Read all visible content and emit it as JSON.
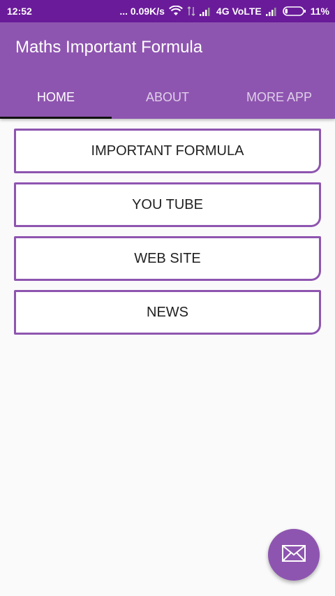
{
  "status_bar": {
    "time": "12:52",
    "network_speed": "... 0.09K/s",
    "network_type": "4G VoLTE",
    "battery": "11%",
    "icons": [
      "wifi-icon",
      "data-arrows-icon",
      "signal-icon",
      "signal-icon-2",
      "battery-icon"
    ]
  },
  "app_bar": {
    "title": "Maths Important Formula"
  },
  "tabs": [
    {
      "label": "HOME",
      "active": true
    },
    {
      "label": "ABOUT",
      "active": false
    },
    {
      "label": "MORE APP",
      "active": false
    }
  ],
  "buttons": [
    {
      "label": "IMPORTANT FORMULA"
    },
    {
      "label": "YOU TUBE"
    },
    {
      "label": "WEB SITE"
    },
    {
      "label": "NEWS"
    }
  ],
  "fab": {
    "icon": "mail-icon"
  },
  "colors": {
    "status_bar": "#6a1b9a",
    "primary": "#8e55b0",
    "background": "#fafafa",
    "button_text": "#212121"
  }
}
